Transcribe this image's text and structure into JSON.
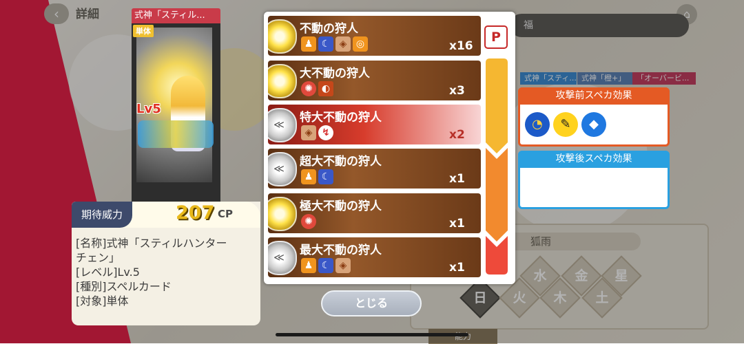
{
  "background": {
    "header_title": "詳細",
    "back_icon": "chevron-left-icon",
    "home_icon": "home-icon",
    "top_bar_text": "福",
    "tabs": [
      "式神「スティ...",
      "式神「橙+」",
      "「オーバービ..."
    ],
    "field_label": "狐雨",
    "elements": [
      "水",
      "金",
      "星",
      "日",
      "火",
      "木",
      "土"
    ],
    "small_label": "能力",
    "accent_red": "#e8214a"
  },
  "card": {
    "title": "式神「スティル...",
    "target_badge": "単体",
    "level": "Lv5"
  },
  "info": {
    "label": "期待威力",
    "cp_value": "207",
    "cp_unit": "CP",
    "lines": [
      "[名称]式神「スティルハンター",
      "チェン」",
      "[レベル]Lv.5",
      "[種別]スペルカード",
      "[対象]単体"
    ]
  },
  "hunters": [
    {
      "name": "不動の狩人",
      "count": "x16",
      "badge": "sun",
      "icons": [
        "orange-figure-icon",
        "blue-moon-icon",
        "shield-gem-icon",
        "target-icon"
      ],
      "selected": false
    },
    {
      "name": "大不動の狩人",
      "count": "x3",
      "badge": "sun",
      "icons": [
        "red-burst-icon",
        "dark-swirl-icon"
      ],
      "selected": false
    },
    {
      "name": "特大不動の狩人",
      "count": "x2",
      "badge": "grey",
      "icons": [
        "shield-gem-icon",
        "white-slash-icon"
      ],
      "selected": true
    },
    {
      "name": "超大不動の狩人",
      "count": "x1",
      "badge": "grey",
      "icons": [
        "orange-figure-icon",
        "blue-moon-icon"
      ],
      "selected": false
    },
    {
      "name": "極大不動の狩人",
      "count": "x1",
      "badge": "sun",
      "icons": [
        "red-burst-icon"
      ],
      "selected": false
    },
    {
      "name": "最大不動の狩人",
      "count": "x1",
      "badge": "grey",
      "icons": [
        "orange-figure-icon",
        "blue-moon-icon",
        "shield-gem-icon"
      ],
      "selected": false
    }
  ],
  "gauge": {
    "p_label": "P",
    "segment_colors": [
      "#f5b731",
      "#f28a2e",
      "#ee4a3a"
    ]
  },
  "effects": {
    "pre_title": "攻撃前スペカ効果",
    "pre_icons": [
      "blue-ear-icon",
      "yellow-feather-icon",
      "blue-gem-icon"
    ],
    "post_title": "攻撃後スペカ効果"
  },
  "close_label": "とじる"
}
